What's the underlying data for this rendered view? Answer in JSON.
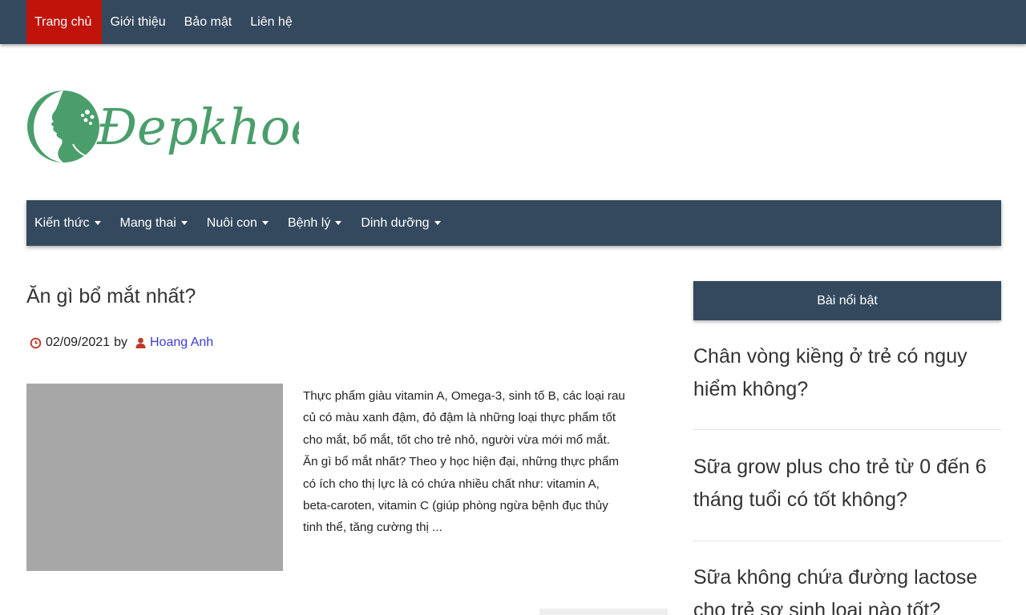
{
  "top_nav": [
    {
      "label": "Trang chủ",
      "active": true
    },
    {
      "label": "Giới thiệu",
      "active": false
    },
    {
      "label": "Bảo mật",
      "active": false
    },
    {
      "label": "Liên hệ",
      "active": false
    }
  ],
  "logo": {
    "text": "Đepkhoe",
    "color": "#4a9e6b"
  },
  "main_nav": [
    "Kiến thức",
    "Mang thai",
    "Nuôi con",
    "Bệnh lý",
    "Dinh dưỡng"
  ],
  "post": {
    "title": "Ăn gì bổ mắt nhất?",
    "date": "02/09/2021",
    "by": "by",
    "author": "Hoang Anh",
    "excerpt_lines": [
      "Thực phẩm giàu vitamin A, Omega-3, sinh tố B, các loại rau",
      "củ có màu xanh đậm, đỏ đậm là những loại thực phẩm tốt",
      "cho mắt, bổ mắt, tốt cho trẻ nhỏ, người vừa mới mổ mắt.",
      "Ăn gì bổ mắt nhất? Theo y học hiện đại, những thực phẩm",
      "có ích cho thị lực là có chứa nhiều chất như:  vitamin A,",
      "beta-caroten, vitamin C (giúp phòng ngừa bệnh đục thủy",
      "tinh thể, tăng cường thị ..."
    ]
  },
  "sidebar": {
    "heading": "Bài nổi bật",
    "items": [
      {
        "line1": "Chân vòng kiềng ở trẻ có nguy",
        "line2": "hiểm không?"
      },
      {
        "line1": "Sữa grow plus cho trẻ từ 0 đến 6",
        "line2": "tháng tuổi có tốt không?"
      },
      {
        "line1": "Sữa không chứa đường lactose",
        "line2": "cho trẻ sơ sinh loại nào tốt?"
      }
    ]
  },
  "colors": {
    "nav_bg": "#34495e",
    "active_bg": "#c0130a",
    "author_link": "#3b3bd9",
    "meta_icon": "#c0392b"
  }
}
